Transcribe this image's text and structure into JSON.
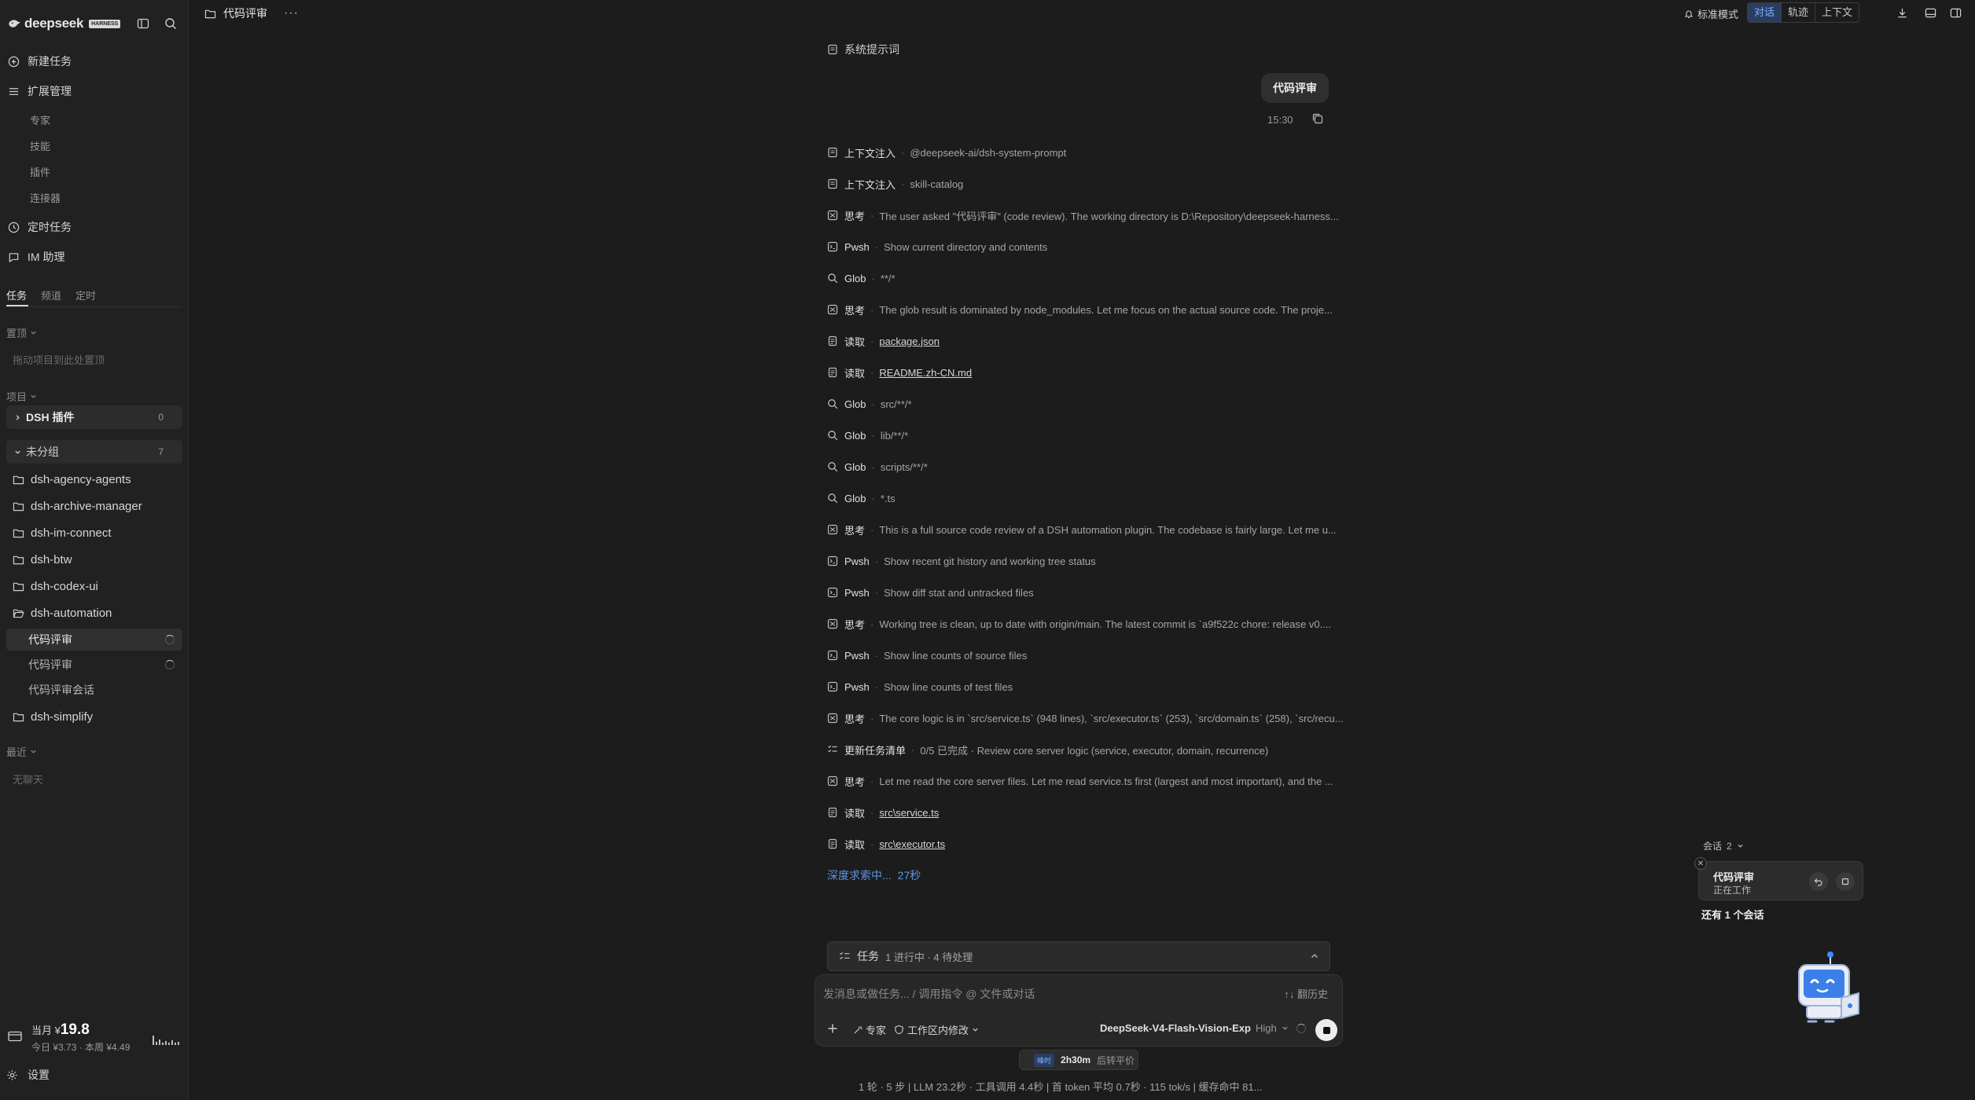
{
  "app": {
    "brand": "deepseek",
    "badge": "HARNESS"
  },
  "sidebar": {
    "nav": [
      {
        "label": "新建任务",
        "icon": "plus-circle-icon"
      },
      {
        "label": "扩展管理",
        "icon": "list-icon"
      },
      {
        "label": "定时任务",
        "icon": "clock-icon"
      },
      {
        "label": "IM 助理",
        "icon": "chat-icon"
      }
    ],
    "extensions": [
      "专家",
      "技能",
      "插件",
      "连接器"
    ],
    "tabs": [
      "任务",
      "频道",
      "定时"
    ],
    "pinned": {
      "label": "置顶",
      "hint": "拖动项目到此处置顶"
    },
    "projects_label": "项目",
    "groups": [
      {
        "name": "DSH 插件",
        "count": "0"
      },
      {
        "name": "未分组",
        "count": "7"
      }
    ],
    "projects_before": [
      "dsh-agency-agents",
      "dsh-archive-manager",
      "dsh-im-connect",
      "dsh-btw",
      "dsh-codex-ui",
      "dsh-automation"
    ],
    "tasks": [
      "代码评审",
      "代码评审",
      "代码评审会话"
    ],
    "projects_after": [
      "dsh-simplify"
    ],
    "recent": {
      "label": "最近",
      "hint": "无聊天"
    },
    "billing": {
      "month_label": "当月 ¥",
      "month_value": "19.8",
      "detail": "今日 ¥3.73 · 本周 ¥4.49"
    },
    "settings": "设置"
  },
  "topbar": {
    "title": "代码评审",
    "more": "···",
    "mode": "标准模式",
    "segments": [
      "对话",
      "轨迹",
      "上下文"
    ],
    "active_segment": "对话"
  },
  "conversation": {
    "system_prompt": "系统提示词",
    "user_message": "代码评审",
    "time": "15:30",
    "steps": [
      {
        "kind": "上下文注入",
        "detail": "@deepseek-ai/dsh-system-prompt",
        "icon": "doc-icon"
      },
      {
        "kind": "上下文注入",
        "detail": "skill-catalog",
        "icon": "doc-icon"
      },
      {
        "kind": "思考",
        "detail": "The user asked \"代码评审\" (code review). The working directory is D:\\Repository\\deepseek-harness...",
        "icon": "brain-icon"
      },
      {
        "kind": "Pwsh",
        "detail": "Show current directory and contents",
        "icon": "terminal-icon"
      },
      {
        "kind": "Glob",
        "detail": "**/*",
        "icon": "search-icon"
      },
      {
        "kind": "思考",
        "detail": "The glob result is dominated by node_modules. Let me focus on the actual source code. The proje...",
        "icon": "brain-icon"
      },
      {
        "kind": "读取",
        "detail": "package.json",
        "icon": "file-icon",
        "link": true
      },
      {
        "kind": "读取",
        "detail": "README.zh-CN.md",
        "icon": "file-icon",
        "link": true
      },
      {
        "kind": "Glob",
        "detail": "src/**/*",
        "icon": "search-icon"
      },
      {
        "kind": "Glob",
        "detail": "lib/**/*",
        "icon": "search-icon"
      },
      {
        "kind": "Glob",
        "detail": "scripts/**/*",
        "icon": "search-icon"
      },
      {
        "kind": "Glob",
        "detail": "*.ts",
        "icon": "search-icon"
      },
      {
        "kind": "思考",
        "detail": "This is a full source code review of a DSH automation plugin. The codebase is fairly large. Let me u...",
        "icon": "brain-icon"
      },
      {
        "kind": "Pwsh",
        "detail": "Show recent git history and working tree status",
        "icon": "terminal-icon"
      },
      {
        "kind": "Pwsh",
        "detail": "Show diff stat and untracked files",
        "icon": "terminal-icon"
      },
      {
        "kind": "思考",
        "detail": "Working tree is clean, up to date with origin/main. The latest commit is `a9f522c chore: release v0....",
        "icon": "brain-icon"
      },
      {
        "kind": "Pwsh",
        "detail": "Show line counts of source files",
        "icon": "terminal-icon"
      },
      {
        "kind": "Pwsh",
        "detail": "Show line counts of test files",
        "icon": "terminal-icon"
      },
      {
        "kind": "思考",
        "detail": "The core logic is in `src/service.ts` (948 lines), `src/executor.ts` (253), `src/domain.ts` (258), `src/recu...",
        "icon": "brain-icon"
      },
      {
        "kind": "更新任务清单",
        "detail": "0/5 已完成 · Review core server logic (service, executor, domain, recurrence)",
        "icon": "checklist-icon"
      },
      {
        "kind": "思考",
        "detail": "Let me read the core server files. Let me read service.ts first (largest and most important), and the ...",
        "icon": "brain-icon"
      },
      {
        "kind": "读取",
        "detail": "src\\service.ts",
        "icon": "file-icon",
        "link": true
      },
      {
        "kind": "读取",
        "detail": "src\\executor.ts",
        "icon": "file-icon",
        "link": true
      }
    ],
    "thinking": {
      "label": "深度求索中...",
      "elapsed": "27秒"
    }
  },
  "tasks_bar": {
    "label": "任务",
    "summary": "1 进行中 · 4 待处理"
  },
  "composer": {
    "placeholder": "发消息或做任务... / 调用指令 @ 文件或对话",
    "history": "↑↓ 翻历史",
    "expert": "专家",
    "workspace": "工作区内修改",
    "model": "DeepSeek-V4-Flash-Vision-Exp",
    "level": "High"
  },
  "timer": {
    "tag": "峰时",
    "duration": "2h30m",
    "suffix": "后转平价"
  },
  "stats": "1 轮 · 5 步  |  LLM 23.2秒 · 工具调用 4.4秒  |  首 token 平均 0.7秒 · 115 tok/s  |  缓存命中 81...",
  "sessions": {
    "header": "会话",
    "count": "2",
    "card_title": "代码评审",
    "card_status": "正在工作",
    "more": "还有 1 个会话"
  }
}
